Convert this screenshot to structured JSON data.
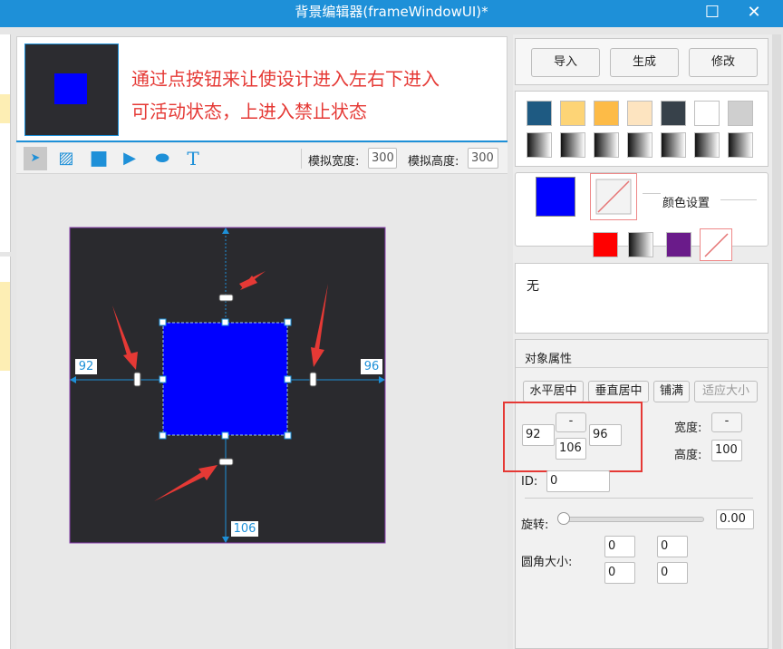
{
  "window": {
    "title": "背景编辑器(frameWindowUI)*",
    "maximize_glyph": "☐",
    "close_glyph": "✕"
  },
  "hint": {
    "line1": "通过点按钮来让使设计进入左右下进入",
    "line2": "可活动状态，上进入禁止状态"
  },
  "toolbar": {
    "tools": [
      {
        "name": "pointer-icon",
        "glyph": "➤"
      },
      {
        "name": "image-icon",
        "glyph": "▨"
      },
      {
        "name": "rectangle-icon",
        "glyph": "■"
      },
      {
        "name": "play-icon",
        "glyph": "▶"
      },
      {
        "name": "ellipse-icon",
        "glyph": "⬬"
      },
      {
        "name": "text-icon",
        "glyph": "T"
      }
    ],
    "sim_width_label": "模拟宽度:",
    "sim_width_value": "300",
    "sim_height_label": "模拟高度:",
    "sim_height_value": "300"
  },
  "canvas": {
    "left_value": "92",
    "right_value": "96",
    "bottom_value": "106"
  },
  "actions": {
    "import_label": "导入",
    "generate_label": "生成",
    "modify_label": "修改"
  },
  "palette": {
    "solid_colors": [
      "#1e5a82",
      "#fdd476",
      "#fdbb47",
      "#fde4c0",
      "#37414a",
      "#ffffff",
      "#cfcfcf"
    ],
    "gradient_count": 7
  },
  "color_settings": {
    "label": "颜色设置",
    "fill_color": "#0000ff",
    "presets": [
      "#ff0000",
      "gradient",
      "#6a1b8a",
      "none"
    ]
  },
  "info_text": "无",
  "object_props": {
    "section_label": "对象属性",
    "h_center_label": "水平居中",
    "v_center_label": "垂直居中",
    "fill_label": "铺满",
    "fit_label": "适应大小",
    "left_value": "92",
    "top_value": "-",
    "right_value": "96",
    "bottom_value": "106",
    "width_label": "宽度:",
    "width_value": "-",
    "height_label": "高度:",
    "height_value": "100",
    "id_label": "ID:",
    "id_value": "0",
    "rotate_label": "旋转:",
    "rotate_value": "0.00",
    "radius_label": "圆角大小:",
    "radius_values": [
      "0",
      "0",
      "0",
      "0"
    ]
  },
  "colors": {
    "accent": "#1e90d8",
    "annotation": "#e53935",
    "canvas_bg": "#2a2a2e",
    "object_fill": "#0000ff",
    "guide": "#1e90d8"
  }
}
